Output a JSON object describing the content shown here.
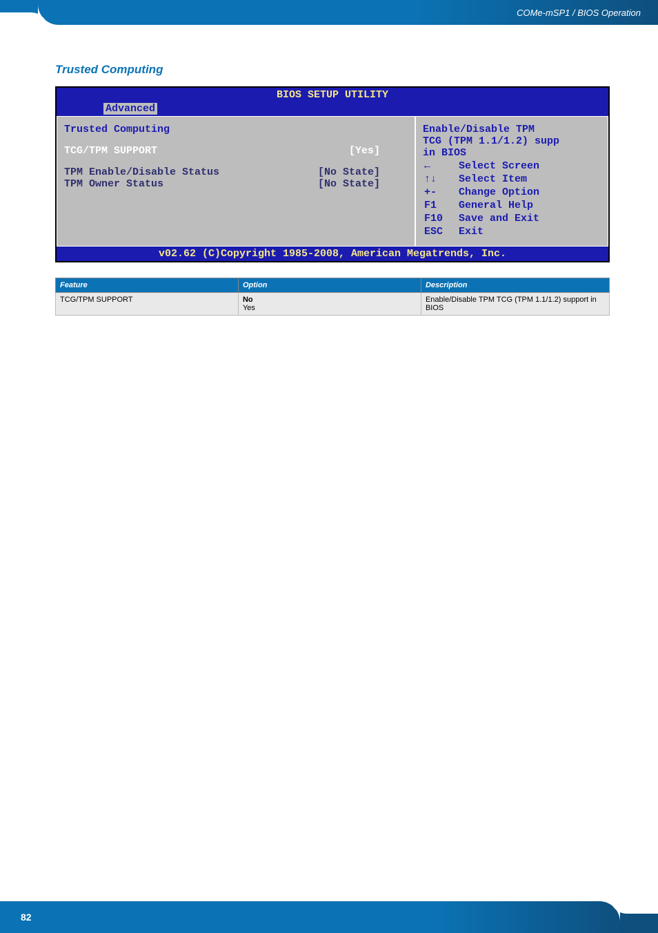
{
  "header": {
    "breadcrumb": "COMe-mSP1 / BIOS Operation"
  },
  "section": {
    "title": "Trusted Computing"
  },
  "bios": {
    "app_title": "BIOS SETUP UTILITY",
    "tab": "Advanced",
    "heading": "Trusted Computing",
    "items": [
      {
        "label": "TCG/TPM SUPPORT",
        "value": "[Yes]",
        "selected": true,
        "dim": false
      },
      {
        "label": "TPM Enable/Disable Status",
        "value": "[No State]",
        "selected": false,
        "dim": true
      },
      {
        "label": "TPM Owner Status",
        "value": "[No State]",
        "selected": false,
        "dim": true
      }
    ],
    "help_text": "Enable/Disable TPM\nTCG (TPM 1.1/1.2) supp\nin BIOS",
    "keys": [
      {
        "key": "←",
        "label": "Select Screen"
      },
      {
        "key": "↑↓",
        "label": "Select Item"
      },
      {
        "key": "+-",
        "label": "Change Option"
      },
      {
        "key": "F1",
        "label": "General Help"
      },
      {
        "key": "F10",
        "label": "Save and Exit"
      },
      {
        "key": "ESC",
        "label": "Exit"
      }
    ],
    "footer": "v02.62 (C)Copyright 1985-2008, American Megatrends, Inc."
  },
  "options_table": {
    "headers": {
      "feature": "Feature",
      "option": "Option",
      "description": "Description"
    },
    "rows": [
      {
        "feature": "TCG/TPM SUPPORT",
        "options": [
          "No",
          "Yes"
        ],
        "description": "Enable/Disable TPM TCG (TPM 1.1/1.2) support in BIOS"
      }
    ]
  },
  "footer": {
    "page": "82"
  },
  "chart_data": {
    "type": "table",
    "title": "Trusted Computing options",
    "columns": [
      "Feature",
      "Option",
      "Description"
    ],
    "rows": [
      [
        "TCG/TPM SUPPORT",
        "No; Yes",
        "Enable/Disable TPM TCG (TPM 1.1/1.2) support in BIOS"
      ]
    ]
  }
}
